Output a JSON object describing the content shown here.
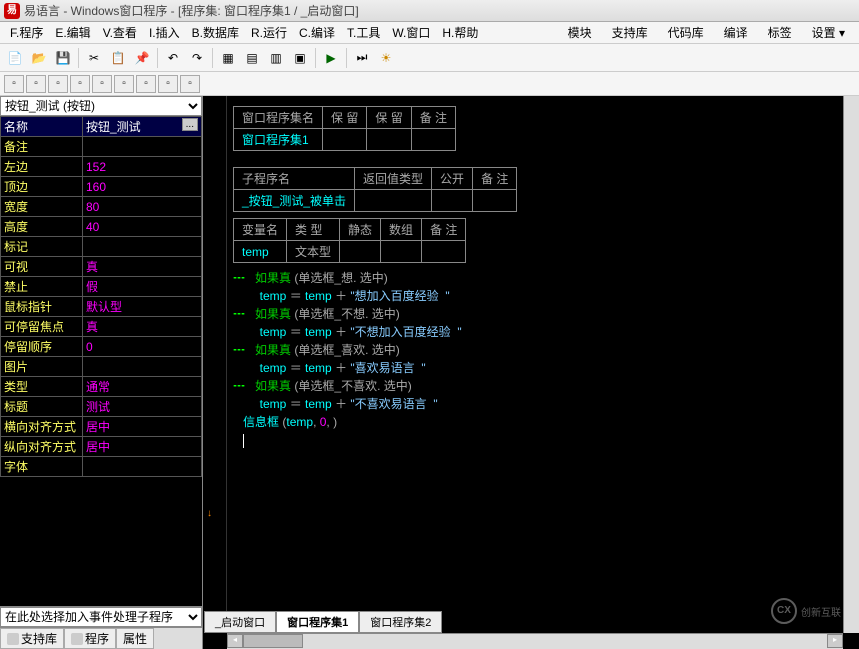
{
  "titlebar": {
    "app_icon_text": "易",
    "title": "易语言 - Windows窗口程序 - [程序集: 窗口程序集1 / _启动窗口]"
  },
  "menu": {
    "items": [
      "F.程序",
      "E.编辑",
      "V.查看",
      "I.插入",
      "B.数据库",
      "R.运行",
      "C.编译",
      "T.工具",
      "W.窗口",
      "H.帮助"
    ],
    "right_items": [
      "模块",
      "支持库",
      "代码库",
      "编译",
      "标签",
      "设置 ▾"
    ]
  },
  "toolbar": {
    "icons": [
      "new",
      "open",
      "save",
      "cut",
      "copy",
      "paste",
      "undo",
      "redo",
      "find",
      "goto",
      "layout1",
      "layout2",
      "layout3",
      "layout4",
      "run",
      "stop",
      "pause",
      "step"
    ]
  },
  "toolbar2": {
    "icons": [
      "align1",
      "align2",
      "align3",
      "align4",
      "align5",
      "align6",
      "align7",
      "align8",
      "align9"
    ]
  },
  "left": {
    "selector": "按钮_测试 (按钮)",
    "props": [
      {
        "key": "名称",
        "val": "按钮_测试",
        "edit": true
      },
      {
        "key": "备注",
        "val": ""
      },
      {
        "key": "左边",
        "val": "152"
      },
      {
        "key": "顶边",
        "val": "160"
      },
      {
        "key": "宽度",
        "val": "80"
      },
      {
        "key": "高度",
        "val": "40"
      },
      {
        "key": "标记",
        "val": ""
      },
      {
        "key": "可视",
        "val": "真"
      },
      {
        "key": "禁止",
        "val": "假"
      },
      {
        "key": "鼠标指针",
        "val": "默认型"
      },
      {
        "key": "可停留焦点",
        "val": "真"
      },
      {
        "key": "  停留顺序",
        "val": "0"
      },
      {
        "key": "图片",
        "val": ""
      },
      {
        "key": "类型",
        "val": "通常"
      },
      {
        "key": "标题",
        "val": "测试"
      },
      {
        "key": "横向对齐方式",
        "val": "居中"
      },
      {
        "key": "纵向对齐方式",
        "val": "居中"
      },
      {
        "key": "字体",
        "val": ""
      }
    ],
    "bottom_combo": "在此处选择加入事件处理子程序",
    "tabs": [
      {
        "label": "支持库",
        "icon": "book"
      },
      {
        "label": "程序",
        "icon": "prog"
      },
      {
        "label": "属性",
        "icon": "props"
      }
    ]
  },
  "code": {
    "table1": {
      "headers": [
        "窗口程序集名",
        "保 留",
        "保 留",
        "备 注"
      ],
      "cells": [
        "窗口程序集1"
      ]
    },
    "table2": {
      "headers": [
        "子程序名",
        "返回值类型",
        "公开",
        "备 注"
      ],
      "cells": [
        "_按钮_测试_被单击"
      ]
    },
    "table3": {
      "headers": [
        "变量名",
        "类 型",
        "静态",
        "数组",
        "备 注"
      ],
      "cells": [
        "temp",
        "文本型"
      ]
    },
    "lines": [
      {
        "indent": 0,
        "type": "if",
        "cond": "单选框_想. 选中"
      },
      {
        "indent": 1,
        "type": "assign",
        "str": "想加入百度经验  "
      },
      {
        "indent": 0,
        "type": "if",
        "cond": "单选框_不想. 选中"
      },
      {
        "indent": 1,
        "type": "assign",
        "str": "不想加入百度经验  "
      },
      {
        "indent": 0,
        "type": "if",
        "cond": "单选框_喜欢. 选中"
      },
      {
        "indent": 1,
        "type": "assign",
        "str": "喜欢易语言  "
      },
      {
        "indent": 0,
        "type": "if",
        "cond": "单选框_不喜欢. 选中"
      },
      {
        "indent": 1,
        "type": "assign",
        "str": "不喜欢易语言  "
      },
      {
        "indent": 0,
        "type": "call"
      }
    ],
    "kw_if": "如果真",
    "kw_temp": "temp",
    "kw_eq": " ＝ ",
    "kw_plus": " ＋ ",
    "kw_quote": "\"",
    "kw_msgbox": "信息框",
    "kw_zero": "0"
  },
  "bottom_tabs": [
    "_启动窗口",
    "窗口程序集1",
    "窗口程序集2"
  ],
  "watermark": {
    "logo": "CX",
    "text": "创新互联"
  }
}
